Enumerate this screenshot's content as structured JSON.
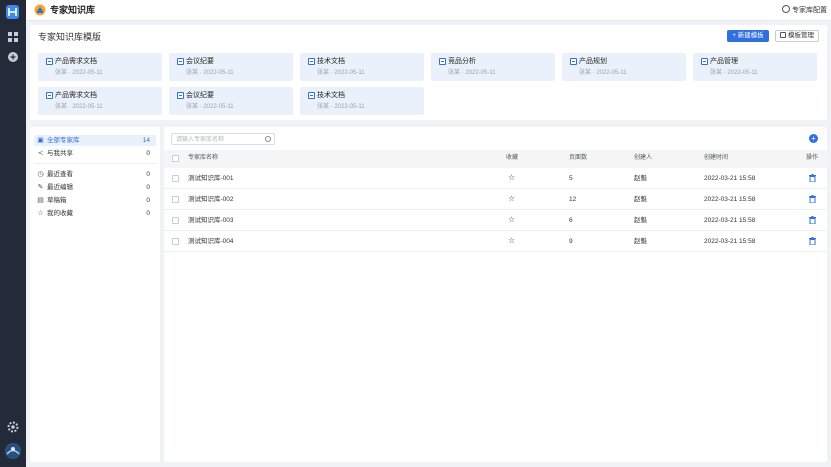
{
  "app": {
    "title": "专家知识库",
    "settings_label": "专家库配置"
  },
  "templates": {
    "title": "专家知识库模版",
    "new_button": "+ 新建模板",
    "manage_button": "模板管理",
    "cards": [
      {
        "name": "产品需求文档",
        "meta": "张某 · 2022-05-11"
      },
      {
        "name": "会议纪要",
        "meta": "张某 · 2022-05-11"
      },
      {
        "name": "技术文档",
        "meta": "张某 · 2022-05-11"
      },
      {
        "name": "竞品分析",
        "meta": "张某 · 2022-05-11"
      },
      {
        "name": "产品规划",
        "meta": "张某 · 2022-05-11"
      },
      {
        "name": "产品管理",
        "meta": "张某 · 2022-05-11"
      },
      {
        "name": "产品需求文档",
        "meta": "张某 · 2022-05-11"
      },
      {
        "name": "会议纪要",
        "meta": "张某 · 2022-05-11"
      },
      {
        "name": "技术文档",
        "meta": "张某 · 2022-05-11"
      }
    ]
  },
  "sidebar": {
    "items": [
      {
        "label": "全部专家库",
        "count": "14",
        "icon": "library-icon"
      },
      {
        "label": "与我共享",
        "count": "0",
        "icon": "share-icon"
      },
      {
        "label": "最近查看",
        "count": "0",
        "icon": "clock-icon"
      },
      {
        "label": "最近编辑",
        "count": "0",
        "icon": "edit-icon"
      },
      {
        "label": "草稿箱",
        "count": "0",
        "icon": "draft-icon"
      },
      {
        "label": "我的收藏",
        "count": "0",
        "icon": "star-icon"
      }
    ]
  },
  "list": {
    "search_placeholder": "请输入专家库名称",
    "columns": {
      "name": "专家库名称",
      "favorite": "收藏",
      "pages": "页面数",
      "creator": "创建人",
      "created": "创建时间",
      "actions": "操作"
    },
    "rows": [
      {
        "name": "测试知识库-001",
        "pages": "5",
        "creator": "赵魁",
        "created": "2022-03-21  15:58"
      },
      {
        "name": "测试知识库-002",
        "pages": "12",
        "creator": "赵魁",
        "created": "2022-03-21  15:58"
      },
      {
        "name": "测试知识库-003",
        "pages": "6",
        "creator": "赵魁",
        "created": "2022-03-21  15:58"
      },
      {
        "name": "测试知识库-004",
        "pages": "9",
        "creator": "赵魁",
        "created": "2022-03-21  15:58"
      }
    ]
  },
  "colors": {
    "accent": "#2f6fde",
    "rail": "#232b3a",
    "card_bg": "#eaf1fb"
  }
}
